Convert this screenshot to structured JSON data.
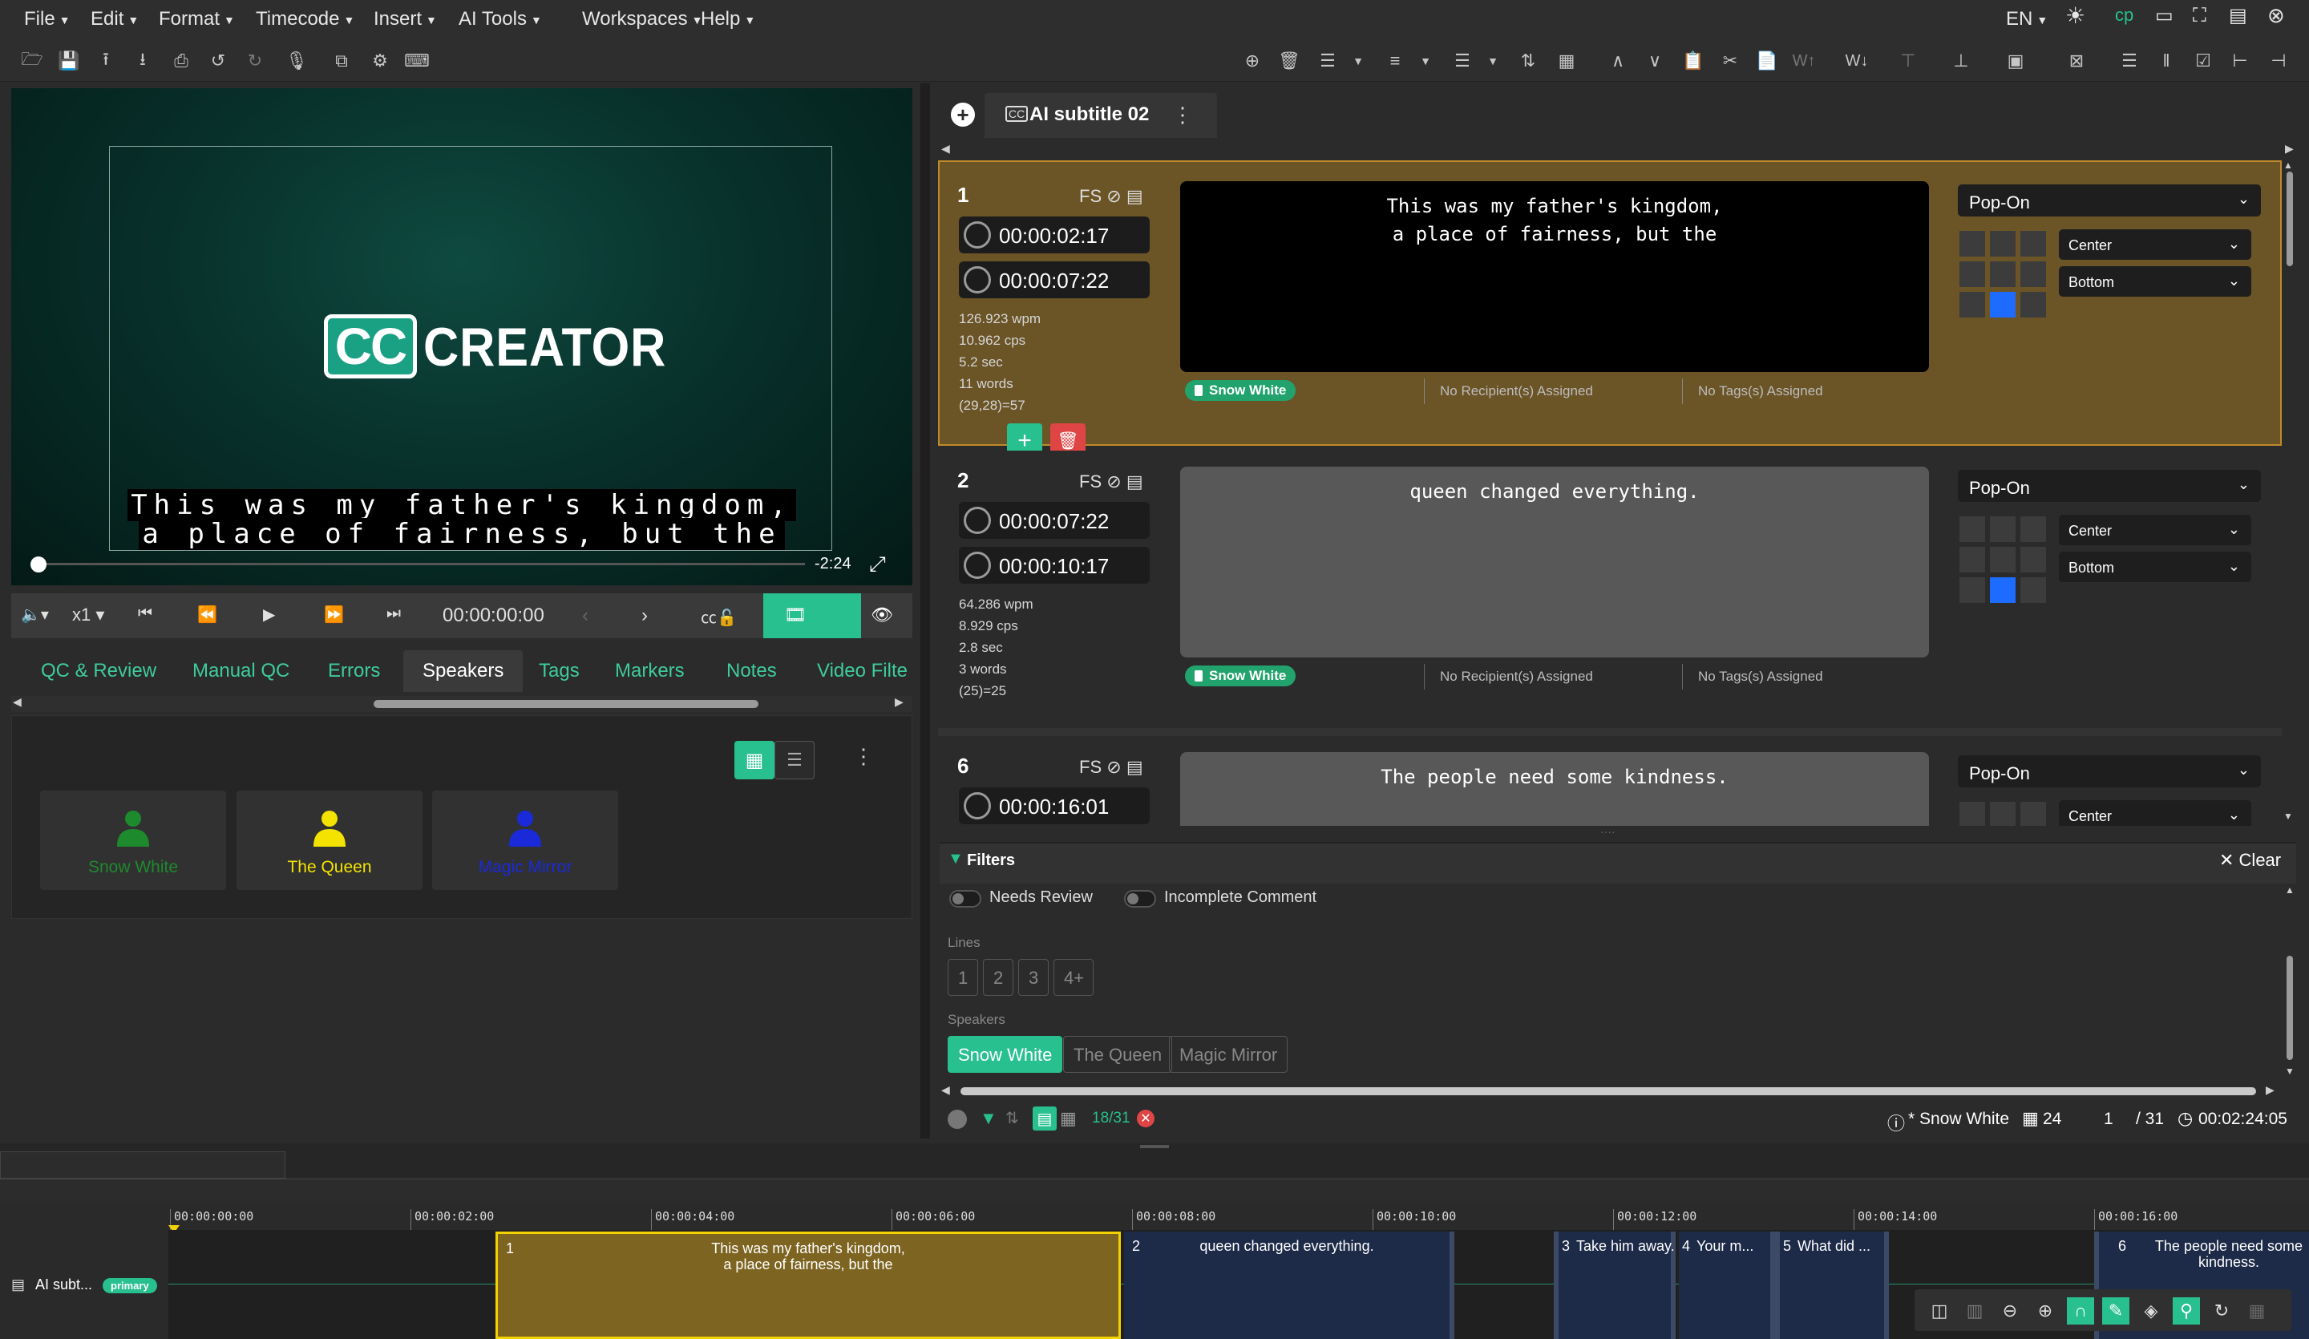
{
  "menubar": {
    "items": [
      "File",
      "Edit",
      "Format",
      "Timecode",
      "Insert",
      "AI Tools",
      "Workspaces",
      "Help"
    ],
    "language": "EN"
  },
  "video": {
    "logo_cc": "CC",
    "logo_text": "CREATOR",
    "caption_line1": "This was my father's kingdom,",
    "caption_line2": "a place of fairness, but the",
    "remaining": "-2:24",
    "speed": "x1",
    "timecode": "00:00:00:00"
  },
  "tabs": [
    "QC & Review",
    "Manual QC",
    "Errors",
    "Speakers",
    "Tags",
    "Markers",
    "Notes",
    "Video Filte"
  ],
  "active_tab": "Speakers",
  "speakers": [
    {
      "name": "Snow White",
      "color": "#1e8a2e"
    },
    {
      "name": "The Queen",
      "color": "#f4e300"
    },
    {
      "name": "Magic Mirror",
      "color": "#1a2ad8"
    }
  ],
  "subtitle_tab": {
    "title": "AI subtitle 02",
    "badge": "CC"
  },
  "cues": [
    {
      "num": "1",
      "fs": "FS",
      "start": "00:00:02:17",
      "end": "00:00:07:22",
      "stats": [
        "126.923 wpm",
        "10.962 cps",
        "5.2 sec",
        "11 words",
        "(29,28)=57"
      ],
      "line1": "This was my father's kingdom,",
      "line2": "a place of fairness, but the",
      "speaker": "Snow White",
      "recipients": "No Recipient(s) Assigned",
      "tags": "No Tags(s) Assigned",
      "mode": "Pop-On",
      "halign": "Center",
      "valign": "Bottom"
    },
    {
      "num": "2",
      "fs": "FS",
      "start": "00:00:07:22",
      "end": "00:00:10:17",
      "stats": [
        "64.286 wpm",
        "8.929 cps",
        "2.8 sec",
        "3 words",
        "(25)=25"
      ],
      "line1": "queen changed everything.",
      "line2": "",
      "speaker": "Snow White",
      "recipients": "No Recipient(s) Assigned",
      "tags": "No Tags(s) Assigned",
      "mode": "Pop-On",
      "halign": "Center",
      "valign": "Bottom"
    },
    {
      "num": "6",
      "fs": "FS",
      "start": "00:00:16:01",
      "line1": "The people need some kindness.",
      "mode": "Pop-On",
      "halign": "Center"
    }
  ],
  "filters": {
    "title": "Filters",
    "clear": "Clear",
    "needs_review": "Needs Review",
    "incomplete_comment": "Incomplete Comment",
    "lines_label": "Lines",
    "lines": [
      "1",
      "2",
      "3",
      "4+"
    ],
    "speakers_label": "Speakers",
    "speakers": [
      "Snow White",
      "The Queen",
      "Magic Mirror"
    ],
    "active_speaker": "Snow White"
  },
  "status": {
    "count": "18/31",
    "speaker": "Snow White",
    "frame": "24",
    "index": "1",
    "total": "/ 31",
    "duration": "00:02:24:05"
  },
  "timeline": {
    "track_name": "AI subt...",
    "track_badge": "primary",
    "ticks": [
      "00:00:00:00",
      "00:00:02:00",
      "00:00:04:00",
      "00:00:06:00",
      "00:00:08:00",
      "00:00:10:00",
      "00:00:12:00",
      "00:00:14:00",
      "00:00:16:00"
    ],
    "clips": [
      {
        "num": "1",
        "text1": "This was my father's kingdom,",
        "text2": "a place of fairness, but the"
      },
      {
        "num": "2",
        "text1": "queen changed everything.",
        "text2": ""
      },
      {
        "num": "3",
        "text1": "Take him away.",
        "text2": ""
      },
      {
        "num": "4",
        "text1": "Your m...",
        "text2": ""
      },
      {
        "num": "5",
        "text1": "What did ...",
        "text2": ""
      },
      {
        "num": "6",
        "text1": "The people need some",
        "text2": "kindness."
      }
    ]
  },
  "colors": {
    "accent": "#27c08e",
    "selected_cue": "#6b5426",
    "timeline_selected": "#7d6421",
    "timeline_clip": "#1d2a48"
  }
}
